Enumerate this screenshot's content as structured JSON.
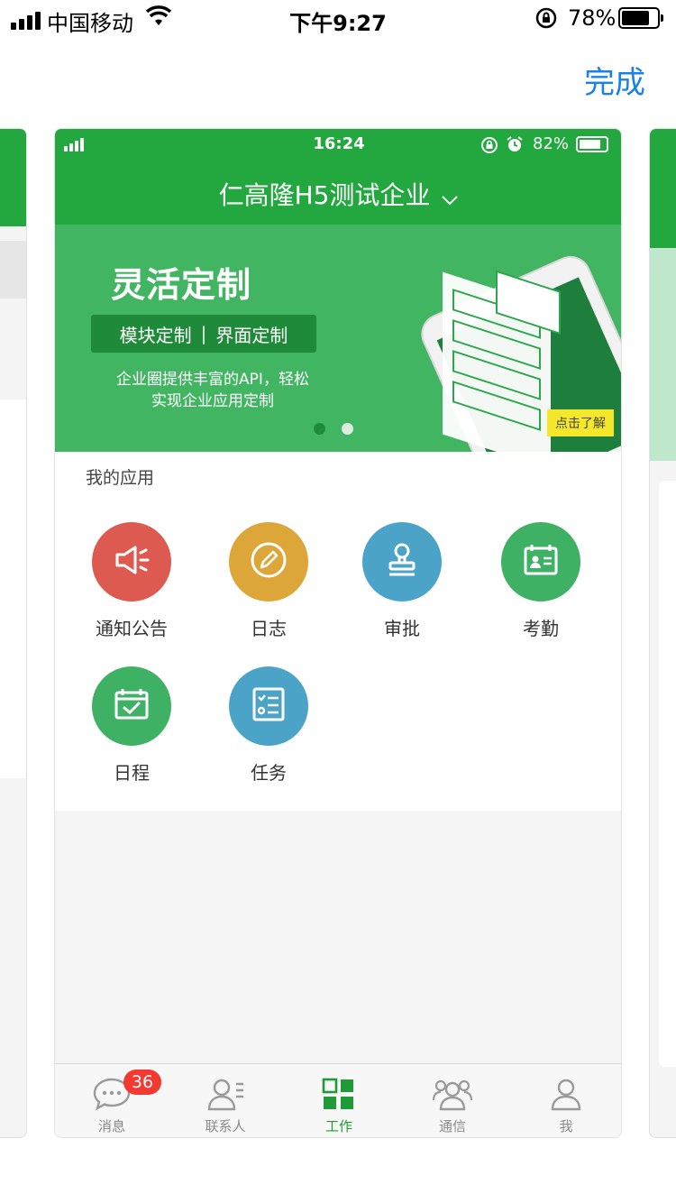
{
  "ios_status": {
    "carrier": "中国移动",
    "time": "下午9:27",
    "battery": "78%",
    "battery_level": 0.78
  },
  "nav": {
    "done_label": "完成"
  },
  "preview": {
    "status": {
      "time": "16:24",
      "battery": "82%",
      "battery_level": 0.82
    },
    "company_name": "仁高隆H5测试企业",
    "banner": {
      "title": "灵活定制",
      "tag1": "模块定制",
      "separator": "|",
      "tag2": "界面定制",
      "desc_line1": "企业圈提供丰富的API，轻松",
      "desc_line2": "实现企业应用定制",
      "cta": "点击了解",
      "slides_count": 2,
      "active_slide": 1
    },
    "apps": {
      "section_title": "我的应用",
      "items": [
        {
          "label": "通知公告",
          "icon": "megaphone-icon",
          "color": "#dc5a50"
        },
        {
          "label": "日志",
          "icon": "pencil-icon",
          "color": "#dca638"
        },
        {
          "label": "审批",
          "icon": "stamp-icon",
          "color": "#4ba3c8"
        },
        {
          "label": "考勤",
          "icon": "id-card-icon",
          "color": "#3eb164"
        },
        {
          "label": "日程",
          "icon": "calendar-check-icon",
          "color": "#3eb164"
        },
        {
          "label": "任务",
          "icon": "task-list-icon",
          "color": "#4ba3c8"
        }
      ]
    },
    "tabbar": {
      "items": [
        {
          "label": "消息",
          "icon": "chat-icon",
          "badge": "36"
        },
        {
          "label": "联系人",
          "icon": "contacts-icon"
        },
        {
          "label": "工作",
          "icon": "grid-icon",
          "active": true
        },
        {
          "label": "通信",
          "icon": "group-icon"
        },
        {
          "label": "我",
          "icon": "person-icon"
        }
      ]
    },
    "colors": {
      "primary_green": "#22a83e",
      "accent_blue": "#1a82e6",
      "badge_red": "#f23a32"
    }
  }
}
